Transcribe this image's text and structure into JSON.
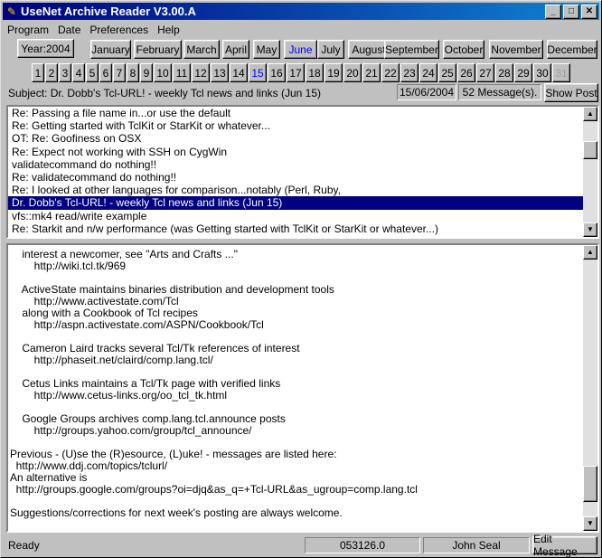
{
  "window": {
    "title": "UseNet Archive Reader V3.00.A",
    "buttons": {
      "minimize": "_",
      "maximize": "□",
      "close": "✕"
    }
  },
  "menubar": [
    {
      "label": "Program"
    },
    {
      "label": "Date"
    },
    {
      "label": "Preferences"
    },
    {
      "label": "Help"
    }
  ],
  "year_button": "Year:2004",
  "months": [
    "January",
    "February",
    "March",
    "April",
    "May",
    "June",
    "July",
    "August",
    "September",
    "October",
    "November",
    "December"
  ],
  "active_month": "June",
  "days": [
    "1",
    "2",
    "3",
    "4",
    "5",
    "6",
    "7",
    "8",
    "9",
    "10",
    "11",
    "12",
    "13",
    "14",
    "15",
    "16",
    "17",
    "18",
    "19",
    "20",
    "21",
    "22",
    "23",
    "24",
    "25",
    "26",
    "27",
    "28",
    "29",
    "30",
    "31"
  ],
  "active_day": "15",
  "disabled_day": "31",
  "subject": "Subject: Dr. Dobb's Tcl-URL! - weekly Tcl news and links (Jun 15)",
  "date_field": "15/06/2004",
  "message_count": "52 Message(s).",
  "show_post_button": "Show Post",
  "message_list": [
    "Re: Passing a file name in...or use the default",
    "Re: Getting started with TclKit or StarKit or whatever...",
    "OT: Re: Goofiness on OSX",
    "Re: Expect not working with SSH on CygWin",
    "validatecommand do nothing!!",
    "Re: validatecommand do nothing!!",
    "Re: I looked at other languages for comparison...notably (Perl, Ruby,",
    "Dr. Dobb's Tcl-URL! - weekly Tcl news and links (Jun 15)",
    "vfs::mk4 read/write example",
    "Re: Starkit and n/w performance (was Getting started with TclKit or StarKit or whatever...)"
  ],
  "selected_index": 7,
  "message_body": [
    "    interest a newcomer, see \"Arts and Crafts ...\"",
    "        http://wiki.tcl.tk/969",
    "",
    "    ActiveState maintains binaries distribution and development tools",
    "        http://www.activestate.com/Tcl",
    "    along with a Cookbook of Tcl recipes",
    "        http://aspn.activestate.com/ASPN/Cookbook/Tcl",
    "",
    "    Cameron Laird tracks several Tcl/Tk references of interest",
    "        http://phaseit.net/claird/comp.lang.tcl/",
    "",
    "    Cetus Links maintains a Tcl/Tk page with verified links",
    "        http://www.cetus-links.org/oo_tcl_tk.html",
    "",
    "    Google Groups archives comp.lang.tcl.announce posts",
    "        http://groups.yahoo.com/group/tcl_announce/",
    "",
    "Previous - (U)se the (R)esource, (L)uke! - messages are listed here:",
    "  http://www.ddj.com/topics/tclurl/",
    "An alternative is",
    "  http://groups.google.com/groups?oi=djq&as_q=+Tcl-URL&as_ugroup=comp.lang.tcl",
    "",
    "Suggestions/corrections for next week's posting are always welcome."
  ],
  "status": {
    "left": "Ready",
    "id": "053126.0",
    "author": "John Seal",
    "edit_button": "Edit Message"
  },
  "icons": {
    "app": "quill-icon",
    "scroll_up": "arrow-up-icon",
    "scroll_down": "arrow-down-icon"
  }
}
